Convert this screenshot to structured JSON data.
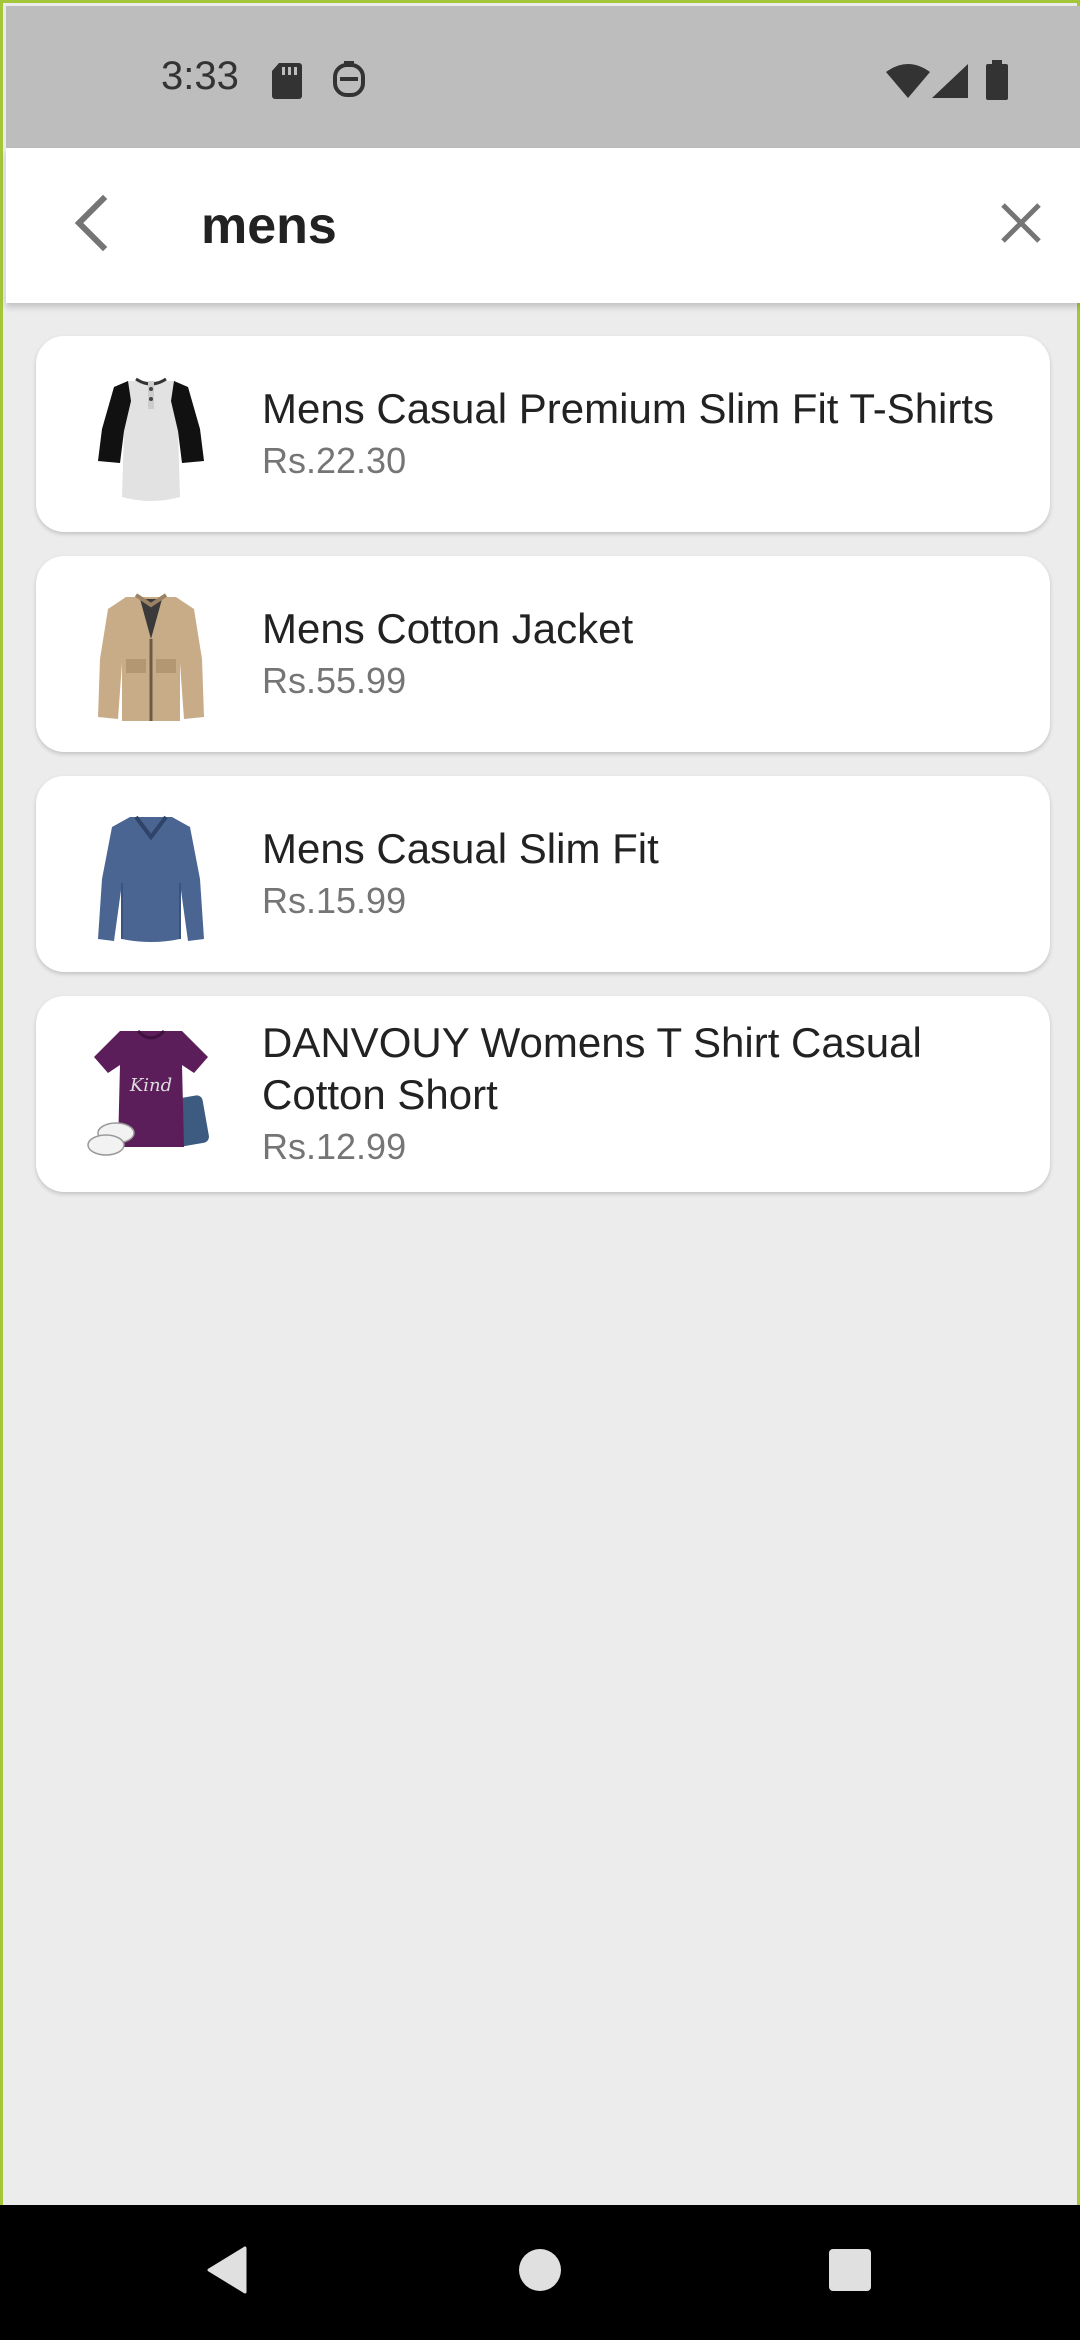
{
  "status_bar": {
    "time": "3:33",
    "icons": [
      "sd-card-icon",
      "android-debug-icon",
      "wifi-icon",
      "cell-signal-icon",
      "battery-icon"
    ]
  },
  "search": {
    "query": "mens",
    "back_icon": "back-chevron-icon",
    "clear_icon": "close-icon"
  },
  "products": [
    {
      "title": "Mens Casual Premium Slim Fit T-Shirts",
      "price": "Rs.22.30",
      "image": "raglan-henley-shirt"
    },
    {
      "title": "Mens Cotton Jacket",
      "price": "Rs.55.99",
      "image": "khaki-jacket"
    },
    {
      "title": "Mens Casual Slim Fit",
      "price": "Rs.15.99",
      "image": "blue-long-sleeve-shirt"
    },
    {
      "title": "DANVOUY Womens T Shirt Casual Cotton Short",
      "price": "Rs.12.99",
      "image": "purple-tshirt"
    }
  ],
  "nav_bar": {
    "icons": [
      "back-triangle-icon",
      "home-circle-icon",
      "recents-square-icon"
    ]
  },
  "colors": {
    "frame_border": "#a4c639",
    "status_bar_bg": "#bdbdbd",
    "page_bg": "#ececec",
    "price_text": "#757575"
  }
}
